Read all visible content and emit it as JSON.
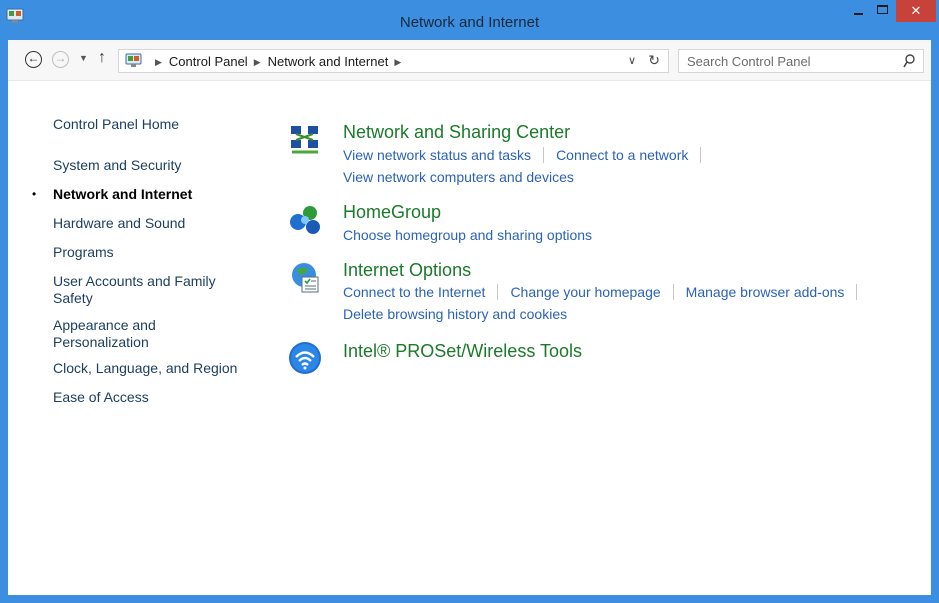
{
  "window": {
    "title": "Network and Internet",
    "close_label": "✕"
  },
  "navigation": {
    "back_glyph": "←",
    "forward_glyph": "→",
    "recent_glyph": "▼",
    "up_glyph": "↑",
    "breadcrumbs": [
      "Control Panel",
      "Network and Internet"
    ],
    "separator_glyph": "▶",
    "dropdown_glyph": "∨",
    "refresh_glyph": "↻"
  },
  "search": {
    "placeholder": "Search Control Panel"
  },
  "sidebar": {
    "items": [
      {
        "label": "Control Panel Home"
      },
      {
        "label": "System and Security"
      },
      {
        "label": "Network and Internet",
        "current": true
      },
      {
        "label": "Hardware and Sound"
      },
      {
        "label": "Programs"
      },
      {
        "label": "User Accounts and Family Safety"
      },
      {
        "label": "Appearance and Personalization"
      },
      {
        "label": "Clock, Language, and Region"
      },
      {
        "label": "Ease of Access"
      }
    ],
    "bullet": "•"
  },
  "categories": [
    {
      "title": "Network and Sharing Center",
      "icon": "network-sharing-icon",
      "links": [
        [
          "View network status and tasks",
          "Connect to a network"
        ],
        [
          "View network computers and devices"
        ]
      ]
    },
    {
      "title": "HomeGroup",
      "icon": "homegroup-icon",
      "links": [
        [
          "Choose homegroup and sharing options"
        ]
      ]
    },
    {
      "title": "Internet Options",
      "icon": "internet-options-icon",
      "links": [
        [
          "Connect to the Internet",
          "Change your homepage",
          "Manage browser add-ons"
        ],
        [
          "Delete browsing history and cookies"
        ]
      ]
    },
    {
      "title": "Intel® PROSet/Wireless Tools",
      "icon": "wireless-tools-icon",
      "links": []
    }
  ],
  "colors": {
    "accent_frame": "#3b8ee0",
    "close_button": "#c7423a",
    "category_title": "#1b7a2a",
    "link": "#2a62b7",
    "sidebar_text": "#1e3f60"
  }
}
